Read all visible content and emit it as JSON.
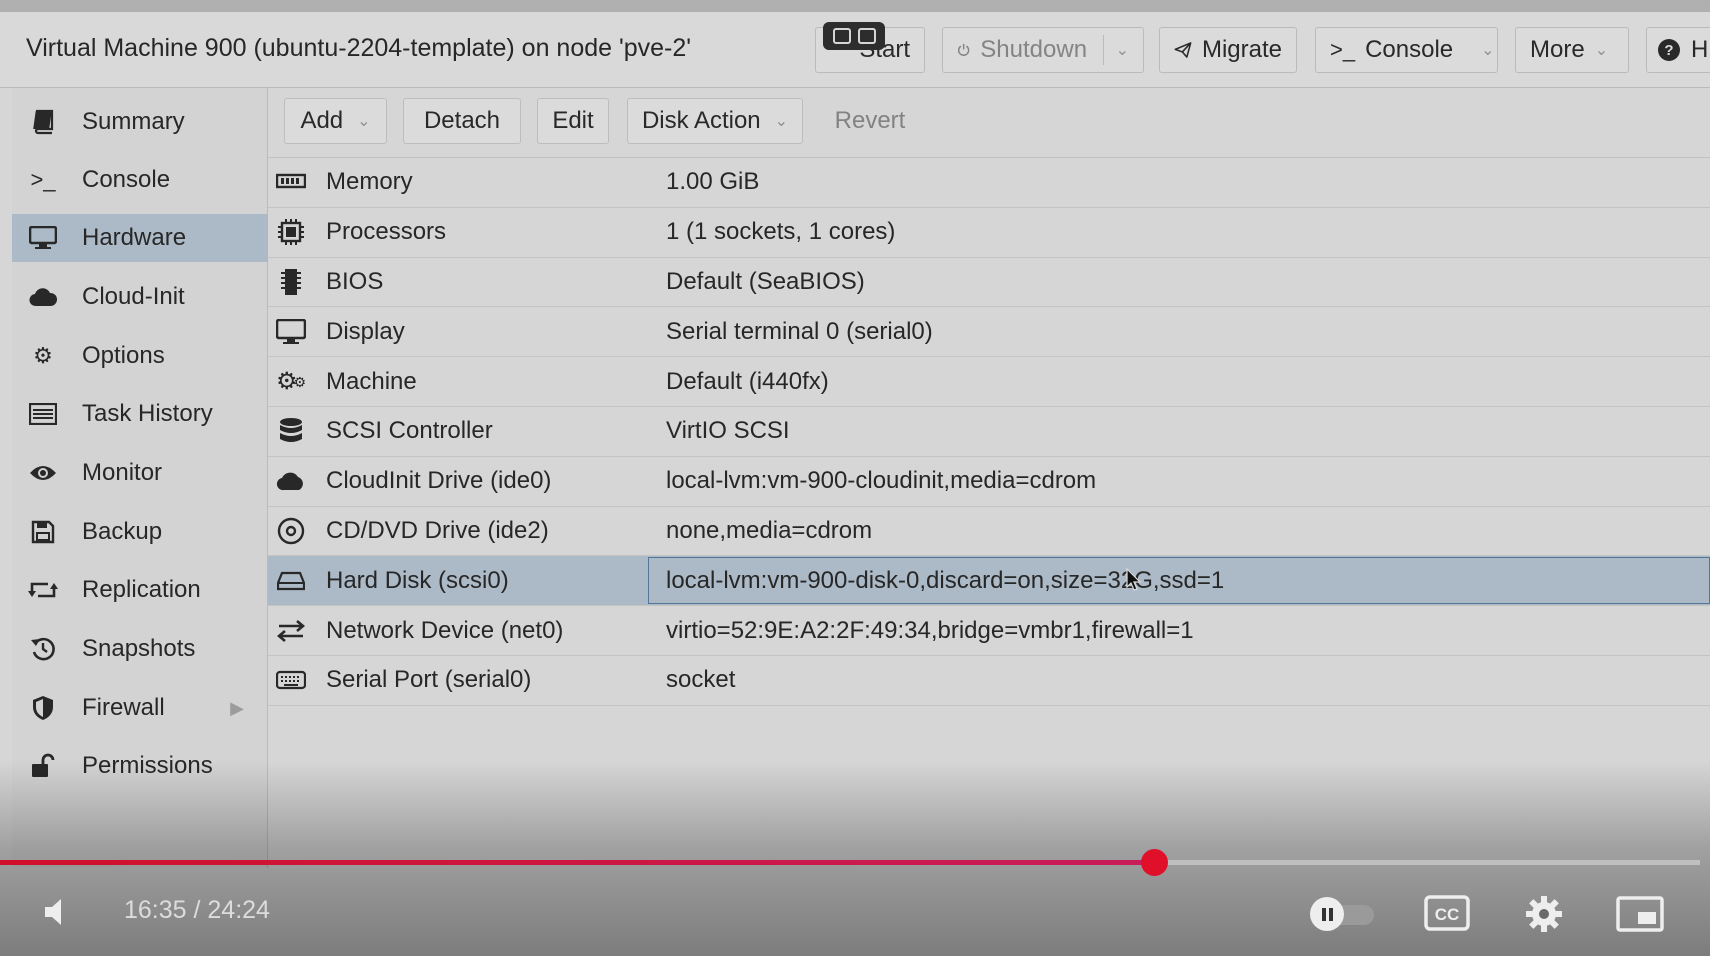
{
  "window": {
    "title": "Virtual Machine 900 (ubuntu-2204-template) on node 'pve-2'"
  },
  "top_toolbar": {
    "start": "Start",
    "shutdown": "Shutdown",
    "migrate": "Migrate",
    "console": "Console",
    "more": "More",
    "help": "H"
  },
  "sidebar": {
    "items": [
      {
        "label": "Summary",
        "icon": "book-icon"
      },
      {
        "label": "Console",
        "icon": "terminal-icon"
      },
      {
        "label": "Hardware",
        "icon": "monitor-icon",
        "selected": true
      },
      {
        "label": "Cloud-Init",
        "icon": "cloud-icon"
      },
      {
        "label": "Options",
        "icon": "gear-icon"
      },
      {
        "label": "Task History",
        "icon": "list-icon"
      },
      {
        "label": "Monitor",
        "icon": "eye-icon"
      },
      {
        "label": "Backup",
        "icon": "floppy-icon"
      },
      {
        "label": "Replication",
        "icon": "retweet-icon"
      },
      {
        "label": "Snapshots",
        "icon": "history-icon"
      },
      {
        "label": "Firewall",
        "icon": "shield-icon"
      },
      {
        "label": "Permissions",
        "icon": "unlock-icon"
      }
    ]
  },
  "hardware_toolbar": {
    "add": "Add",
    "detach": "Detach",
    "edit": "Edit",
    "disk_action": "Disk Action",
    "revert": "Revert"
  },
  "hardware": {
    "rows": [
      {
        "name": "Memory",
        "value": "1.00 GiB",
        "icon": "memory-icon"
      },
      {
        "name": "Processors",
        "value": "1 (1 sockets, 1 cores)",
        "icon": "cpu-icon"
      },
      {
        "name": "BIOS",
        "value": "Default (SeaBIOS)",
        "icon": "microchip-icon"
      },
      {
        "name": "Display",
        "value": "Serial terminal 0 (serial0)",
        "icon": "desktop-icon"
      },
      {
        "name": "Machine",
        "value": "Default (i440fx)",
        "icon": "cogs-icon"
      },
      {
        "name": "SCSI Controller",
        "value": "VirtIO SCSI",
        "icon": "database-icon"
      },
      {
        "name": "CloudInit Drive (ide0)",
        "value": "local-lvm:vm-900-cloudinit,media=cdrom",
        "icon": "cloud-icon"
      },
      {
        "name": "CD/DVD Drive (ide2)",
        "value": "none,media=cdrom",
        "icon": "cdrom-icon"
      },
      {
        "name": "Hard Disk (scsi0)",
        "value": "local-lvm:vm-900-disk-0,discard=on,size=32G,ssd=1",
        "icon": "hdd-icon",
        "selected": true
      },
      {
        "name": "Network Device (net0)",
        "value": "virtio=52:9E:A2:2F:49:34,bridge=vmbr1,firewall=1",
        "icon": "exchange-icon"
      },
      {
        "name": "Serial Port (serial0)",
        "value": "socket",
        "icon": "keyboard-icon"
      }
    ]
  },
  "video": {
    "time": "16:35 / 24:24",
    "progress_fraction": 0.679
  }
}
